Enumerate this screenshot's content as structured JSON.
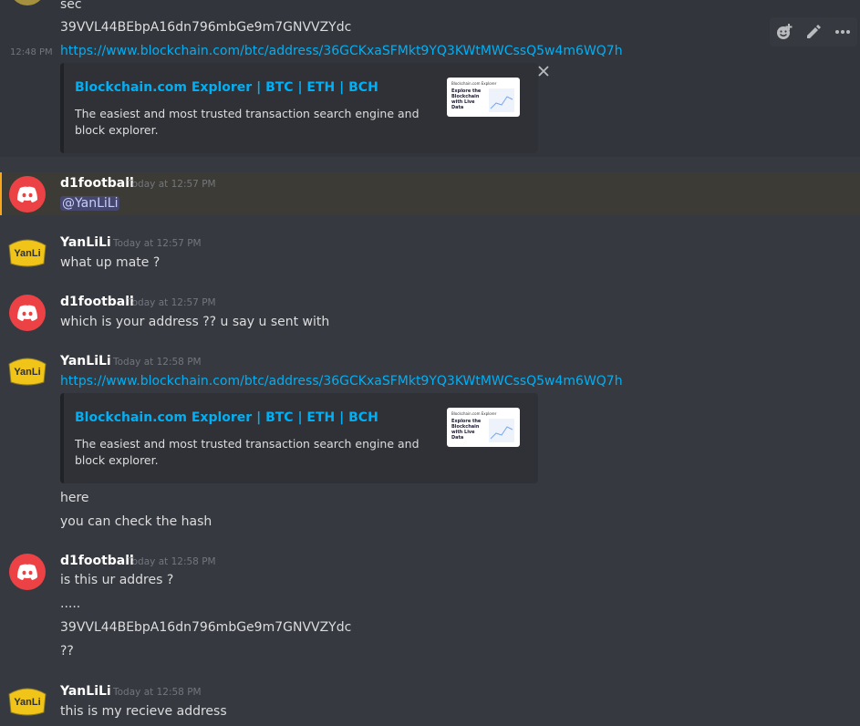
{
  "messages": {
    "top_fragment": "sec",
    "top_address": "39VVL44BEbpA16dn796mbGe9m7GNVVZYdc",
    "side_time": "12:48 PM",
    "link1": "https://www.blockchain.com/btc/address/36GCKxaSFMkt9YQ3KWtMWCssQ5w4m6WQ7h",
    "embed1": {
      "title": "Blockchain.com Explorer | BTC | ETH | BCH",
      "desc": "The easiest and most trusted transaction search engine and block explorer."
    },
    "thumb": {
      "brand": "Blockchain.com Explorer",
      "headline": "Explore the Blockchain with Live Data"
    },
    "g1": {
      "user": "d1football",
      "time": "Today at 12:57 PM",
      "mention": "@YanLiLi"
    },
    "g2": {
      "user": "YanLiLi",
      "time": "Today at 12:57 PM",
      "text": "what up mate ?"
    },
    "g3": {
      "user": "d1football",
      "time": "Today at 12:57 PM",
      "text": "which is your address ?? u say u sent with"
    },
    "g4": {
      "user": "YanLiLi",
      "time": "Today at 12:58 PM",
      "link": "https://www.blockchain.com/btc/address/36GCKxaSFMkt9YQ3KWtMWCssQ5w4m6WQ7h",
      "embed_title": "Blockchain.com Explorer | BTC | ETH | BCH",
      "embed_desc": "The easiest and most trusted transaction search engine and block explorer.",
      "line1": "here",
      "line2": "you can check the hash"
    },
    "g5": {
      "user": "d1football",
      "time": "Today at 12:58 PM",
      "line1": "is this ur addres ?",
      "line2": ".....",
      "line3": "39VVL44BEbpA16dn796mbGe9m7GNVVZYdc",
      "line4": "??"
    },
    "g6": {
      "user": "YanLiLi",
      "time": "Today at 12:58 PM",
      "text": "this is my recieve address"
    }
  },
  "avatar_text": "YanLi",
  "colors": {
    "background": "#36393f",
    "link": "#00aff4",
    "discord_red": "#ed4245",
    "mention_highlight": "#faa81a"
  },
  "icons": [
    "add-reaction-icon",
    "edit-icon",
    "more-icon",
    "close-icon",
    "discord-logo-icon"
  ]
}
